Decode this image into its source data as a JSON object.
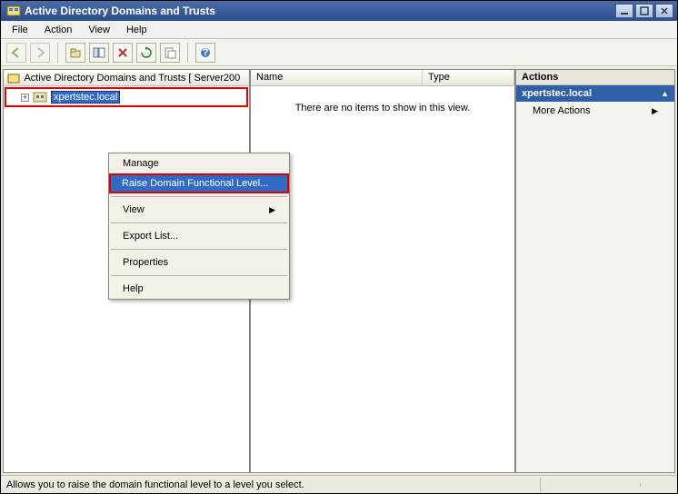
{
  "title": "Active Directory Domains and Trusts",
  "menus": {
    "file": "File",
    "action": "Action",
    "view": "View",
    "help": "Help"
  },
  "toolbar_icons": [
    "back",
    "forward",
    "up",
    "props",
    "close",
    "refresh",
    "export",
    "help"
  ],
  "tree": {
    "root": "Active Directory Domains and Trusts [ Server200",
    "node1": "xpertstec.local"
  },
  "list": {
    "cols": {
      "name": "Name",
      "type": "Type"
    },
    "empty": "There are no items to show in this view."
  },
  "actions": {
    "header": "Actions",
    "selected": "xpertstec.local",
    "more": "More Actions"
  },
  "ctx": {
    "manage": "Manage",
    "raise": "Raise Domain Functional Level...",
    "view": "View",
    "export": "Export List...",
    "properties": "Properties",
    "help": "Help"
  },
  "status": "Allows you to raise the domain functional level to a level you select."
}
